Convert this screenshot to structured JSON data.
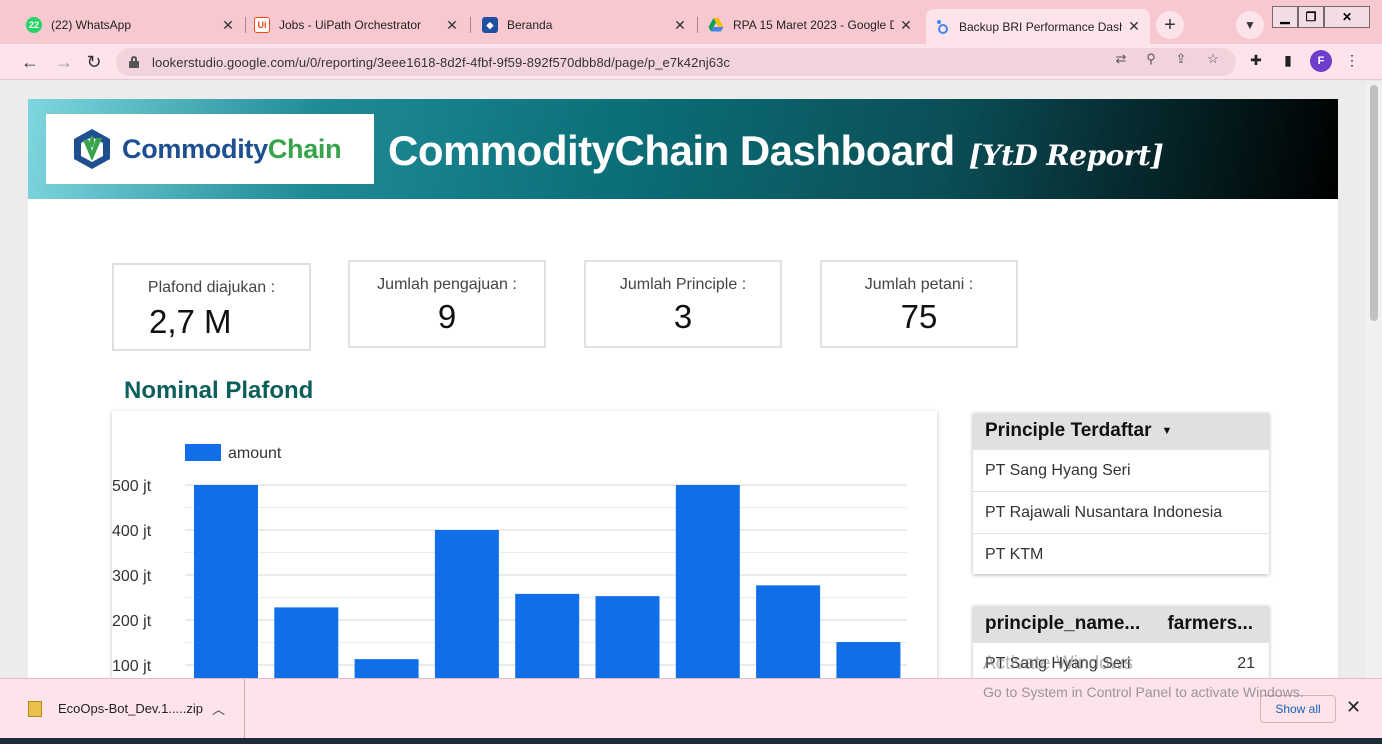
{
  "browser": {
    "tabs": [
      {
        "title": "(22) WhatsApp",
        "favicon": "whatsapp-icon",
        "badge": "22",
        "color": "#25d366"
      },
      {
        "title": "Jobs - UiPath Orchestrator",
        "favicon": "uipath-icon",
        "badge": "Ui",
        "color": "#fa4616"
      },
      {
        "title": "Beranda",
        "favicon": "shield-icon",
        "badge": "",
        "color": "#1f4fa0"
      },
      {
        "title": "RPA 15 Maret 2023 - Google D",
        "favicon": "google-drive-icon",
        "badge": "",
        "color": "#fbbc04"
      },
      {
        "title": "Backup BRI Performance Dashb",
        "favicon": "looker-studio-icon",
        "badge": "",
        "color": "#4285f4"
      }
    ],
    "url": "lookerstudio.google.com/u/0/reporting/3eee1618-8d2f-4fbf-9f59-892f570dbb8d/page/p_e7k42nj63c",
    "profile_initial": "F",
    "new_tab_label": "+"
  },
  "report": {
    "brand_commodity": "Commodity",
    "brand_chain": "Chain",
    "title": "CommodityChain Dashboard",
    "subtitle": "[YtD Report]",
    "kpis": [
      {
        "label": "Plafond diajukan :",
        "value": "2,7 M"
      },
      {
        "label": "Jumlah pengajuan :",
        "value": "9"
      },
      {
        "label": "Jumlah Principle :",
        "value": "3"
      },
      {
        "label": "Jumlah petani :",
        "value": "75"
      }
    ],
    "section_title": "Nominal Plafond",
    "principle_table": {
      "header": "Principle Terdaftar",
      "rows": [
        "PT Sang Hyang Seri",
        "PT Rajawali Nusantara Indonesia",
        "PT KTM"
      ]
    },
    "farmers_table": {
      "col1": "principle_name...",
      "col2": "farmers...",
      "rows": [
        {
          "name": "PT Sang Hyang Seri",
          "farmers": "21"
        }
      ]
    }
  },
  "chart_data": {
    "type": "bar",
    "series": [
      {
        "name": "amount",
        "values": [
          500,
          228,
          113,
          400,
          258,
          253,
          500,
          277,
          151
        ]
      }
    ],
    "y_unit": "jt",
    "y_ticks": [
      "100 jt",
      "200 jt",
      "300 jt",
      "400 jt",
      "500 jt"
    ],
    "y_tick_values": [
      100,
      200,
      300,
      400,
      500
    ],
    "ylim": [
      0,
      500
    ],
    "bar_color": "#0f6ee8",
    "legend_position": "top-left"
  },
  "downloads": {
    "file": "EcoOps-Bot_Dev.1.....zip",
    "show_all": "Show all"
  },
  "watermark": {
    "line1": "Activate Windows",
    "line2": "Go to System in Control Panel to activate Windows."
  }
}
